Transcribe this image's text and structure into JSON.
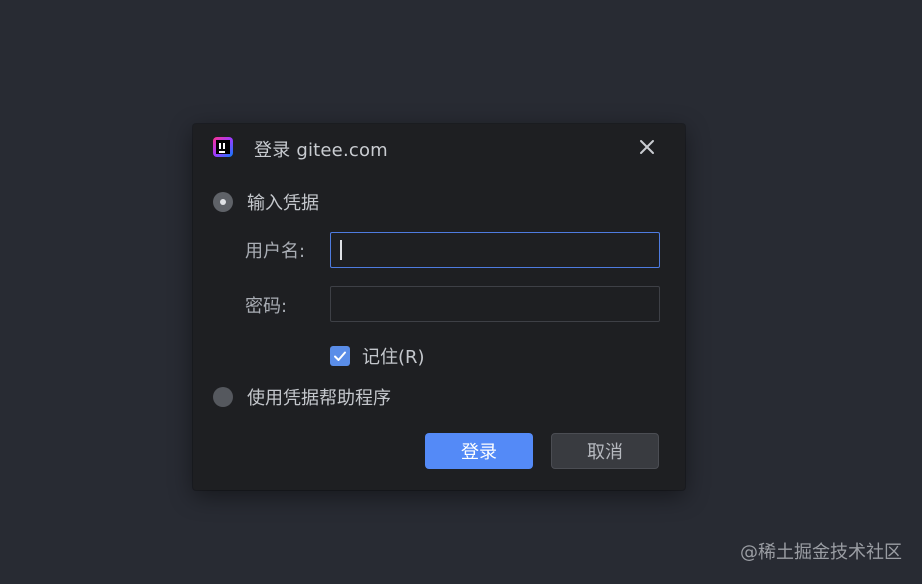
{
  "dialog": {
    "title": "登录 gitee.com",
    "close_icon": "close-icon",
    "app_icon": "jetbrains-ide-icon"
  },
  "auth_options": {
    "credentials_label": "输入凭据",
    "helper_label": "使用凭据帮助程序",
    "selected": "credentials"
  },
  "form": {
    "username_label": "用户名:",
    "username_value": "",
    "password_label": "密码:",
    "password_value": "",
    "remember_label": "记住(R)",
    "remember_checked": true
  },
  "buttons": {
    "login_label": "登录",
    "cancel_label": "取消"
  },
  "watermark": "@稀土掘金技术社区",
  "colors": {
    "background": "#282b33",
    "dialog": "#1e1f22",
    "accent": "#548af7",
    "focus_border": "#4e7be0"
  }
}
